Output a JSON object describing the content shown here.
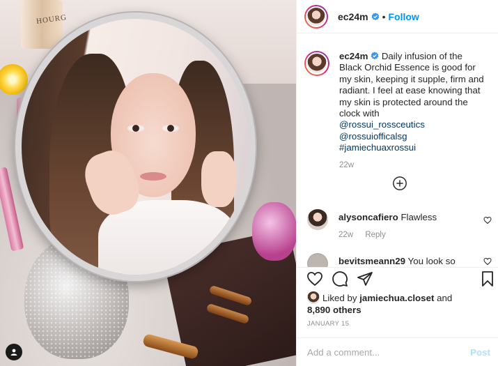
{
  "post": {
    "username": "ec24m",
    "separator": "•",
    "follow_label": "Follow",
    "photo_brand_text": "HOURG"
  },
  "caption": {
    "username": "ec24m",
    "text": "Daily infusion of the Black Orchid Essence is good for my skin, keeping it supple, firm and radiant. I feel at ease knowing that my skin is protected around the clock with",
    "mentions": [
      "@rossui_rossceutics",
      "@rossuiofficalsg",
      "#jamiechuaxrossui"
    ],
    "time": "22w"
  },
  "comments": [
    {
      "username": "alysoncafiero",
      "text": "Flawless",
      "time": "22w",
      "reply_label": "Reply"
    },
    {
      "username": "bevitsmeann29",
      "text": "You look so"
    }
  ],
  "likes": {
    "prefix": "Liked by",
    "user": "jamiechua.closet",
    "and": "and",
    "count": "8,890 others"
  },
  "date": "JANUARY 15",
  "add_comment": {
    "placeholder": "Add a comment...",
    "post_label": "Post"
  },
  "icons": {
    "verified": "verified-badge-icon",
    "load_more": "plus-circle-icon",
    "like": "heart-icon",
    "comment": "comment-bubble-icon",
    "share": "paper-plane-icon",
    "save": "bookmark-icon",
    "tag": "user-tag-icon"
  },
  "colors": {
    "accent": "#0095f6",
    "verified": "#3897f0",
    "mention": "#00376b",
    "muted": "#8e8e8e",
    "post_disabled": "#b2dffc"
  }
}
